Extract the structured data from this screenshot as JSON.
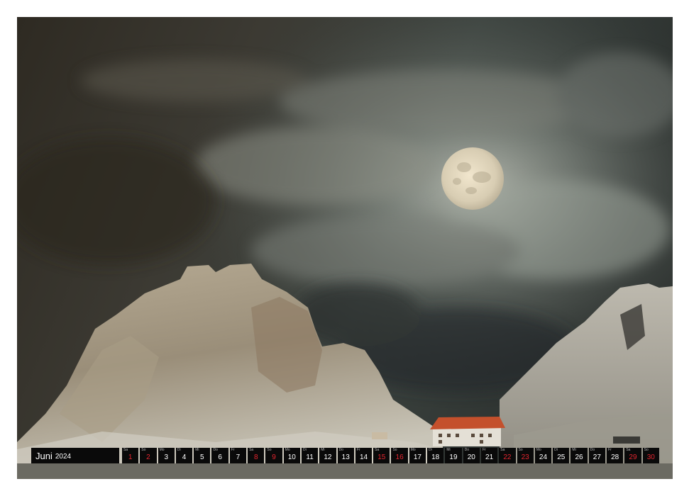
{
  "calendar": {
    "month": "Juni",
    "year": "2024",
    "days": [
      {
        "wd": "Sa",
        "n": "1",
        "we": true
      },
      {
        "wd": "So",
        "n": "2",
        "we": true
      },
      {
        "wd": "Mo",
        "n": "3",
        "we": false
      },
      {
        "wd": "Di",
        "n": "4",
        "we": false
      },
      {
        "wd": "Mi",
        "n": "5",
        "we": false
      },
      {
        "wd": "Do",
        "n": "6",
        "we": false
      },
      {
        "wd": "Fr",
        "n": "7",
        "we": false
      },
      {
        "wd": "Sa",
        "n": "8",
        "we": true
      },
      {
        "wd": "So",
        "n": "9",
        "we": true
      },
      {
        "wd": "Mo",
        "n": "10",
        "we": false
      },
      {
        "wd": "Di",
        "n": "11",
        "we": false
      },
      {
        "wd": "Mi",
        "n": "12",
        "we": false
      },
      {
        "wd": "Do",
        "n": "13",
        "we": false
      },
      {
        "wd": "Fr",
        "n": "14",
        "we": false
      },
      {
        "wd": "Sa",
        "n": "15",
        "we": true
      },
      {
        "wd": "So",
        "n": "16",
        "we": true
      },
      {
        "wd": "Mo",
        "n": "17",
        "we": false
      },
      {
        "wd": "Di",
        "n": "18",
        "we": false
      },
      {
        "wd": "Mi",
        "n": "19",
        "we": false
      },
      {
        "wd": "Do",
        "n": "20",
        "we": false
      },
      {
        "wd": "Fr",
        "n": "21",
        "we": false
      },
      {
        "wd": "Sa",
        "n": "22",
        "we": true
      },
      {
        "wd": "So",
        "n": "23",
        "we": true
      },
      {
        "wd": "Mo",
        "n": "24",
        "we": false
      },
      {
        "wd": "Di",
        "n": "25",
        "we": false
      },
      {
        "wd": "Mi",
        "n": "26",
        "we": false
      },
      {
        "wd": "Do",
        "n": "27",
        "we": false
      },
      {
        "wd": "Fr",
        "n": "28",
        "we": false
      },
      {
        "wd": "Sa",
        "n": "29",
        "we": true
      },
      {
        "wd": "So",
        "n": "30",
        "we": true
      }
    ]
  },
  "colors": {
    "bar": "#0a0a0a",
    "weekend": "#e4252f",
    "weekday": "#ffffff"
  }
}
